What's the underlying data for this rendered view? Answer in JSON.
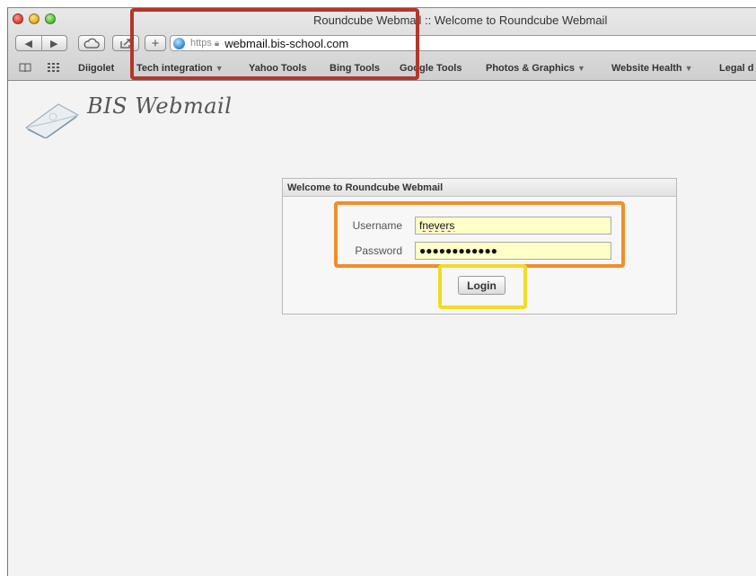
{
  "browser": {
    "window_title": "Roundcube Webmail :: Welcome to Roundcube Webmail",
    "address_scheme": "https",
    "address_url": "webmail.bis-school.com",
    "bookmarks": [
      {
        "label": "Diigolet",
        "menu": false
      },
      {
        "label": "Tech integration",
        "menu": true
      },
      {
        "label": "Yahoo Tools",
        "menu": false
      },
      {
        "label": "Bing Tools",
        "menu": false
      },
      {
        "label": "Google Tools",
        "menu": false
      },
      {
        "label": "Photos & Graphics",
        "menu": true
      },
      {
        "label": "Website Health",
        "menu": true
      },
      {
        "label": "Legal d",
        "menu": false
      }
    ],
    "menu_arrow": "▼"
  },
  "page": {
    "logo_text": "BIS Webmail",
    "login_box": {
      "heading": "Welcome to Roundcube Webmail",
      "username_label": "Username",
      "username_value": "fnevers",
      "password_label": "Password",
      "password_value": "●●●●●●●●●●●●",
      "login_button": "Login"
    }
  },
  "annotations": {
    "address_highlight_color": "#b3372a",
    "credentials_highlight_color": "#f08e2a",
    "login_highlight_color": "#f0dc26"
  }
}
